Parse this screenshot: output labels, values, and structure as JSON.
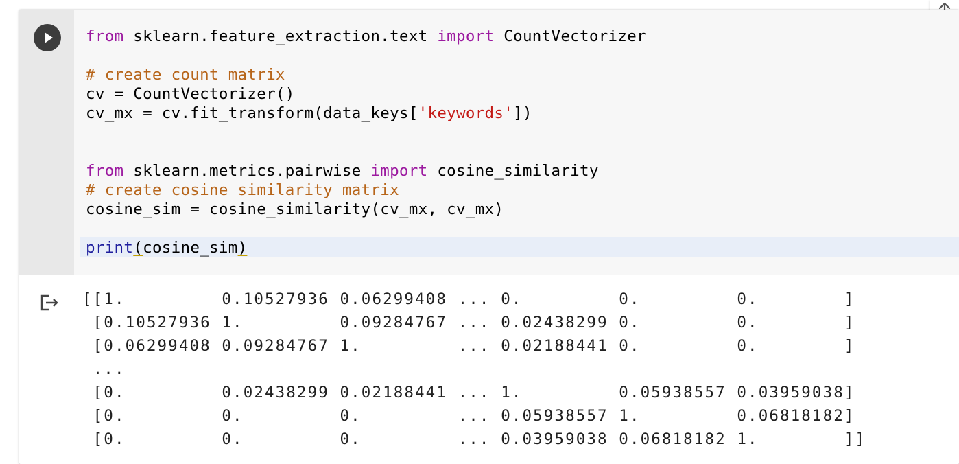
{
  "code_cell": {
    "lines": [
      [
        {
          "t": "from",
          "c": "kw"
        },
        {
          "t": " sklearn.feature_extraction.text ",
          "c": ""
        },
        {
          "t": "import",
          "c": "kw"
        },
        {
          "t": " CountVectorizer",
          "c": ""
        }
      ],
      [],
      [
        {
          "t": "# create count matrix",
          "c": "cm"
        }
      ],
      [
        {
          "t": "cv = CountVectorizer()",
          "c": ""
        }
      ],
      [
        {
          "t": "cv_mx = cv.fit_transform(data_keys[",
          "c": ""
        },
        {
          "t": "'keywords'",
          "c": "st"
        },
        {
          "t": "])",
          "c": ""
        }
      ],
      [],
      [],
      [
        {
          "t": "from",
          "c": "kw"
        },
        {
          "t": " sklearn.metrics.pairwise ",
          "c": ""
        },
        {
          "t": "import",
          "c": "kw"
        },
        {
          "t": " cosine_similarity",
          "c": ""
        }
      ],
      [
        {
          "t": "# create cosine similarity matrix",
          "c": "cm"
        }
      ],
      [
        {
          "t": "cosine_sim = cosine_similarity(cv_mx, cv_mx)",
          "c": ""
        }
      ],
      [],
      [
        {
          "t": "print",
          "c": "bi"
        },
        {
          "t": "(",
          "c": "ul"
        },
        {
          "t": "cosine_sim",
          "c": ""
        },
        {
          "t": ")",
          "c": "ul"
        }
      ]
    ]
  },
  "output": {
    "lines": [
      "[[1.         0.10527936 0.06299408 ... 0.         0.         0.        ]",
      " [0.10527936 1.         0.09284767 ... 0.02438299 0.         0.        ]",
      " [0.06299408 0.09284767 1.         ... 0.02188441 0.         0.        ]",
      " ...",
      " [0.         0.02438299 0.02188441 ... 1.         0.05938557 0.03959038]",
      " [0.         0.         0.         ... 0.05938557 1.         0.06818182]",
      " [0.         0.         0.         ... 0.03959038 0.06818182 1.        ]]"
    ]
  },
  "icons": {
    "run": "play-icon",
    "output": "output-arrow-icon",
    "scroll_top": "arrow-up-icon"
  },
  "colors": {
    "keyword": "#9c1aa0",
    "comment": "#b7651a",
    "string": "#c41a16",
    "builtin": "#1f1f9e",
    "gutter": "#e8e8e8",
    "code_bg": "#f7f7f7"
  }
}
